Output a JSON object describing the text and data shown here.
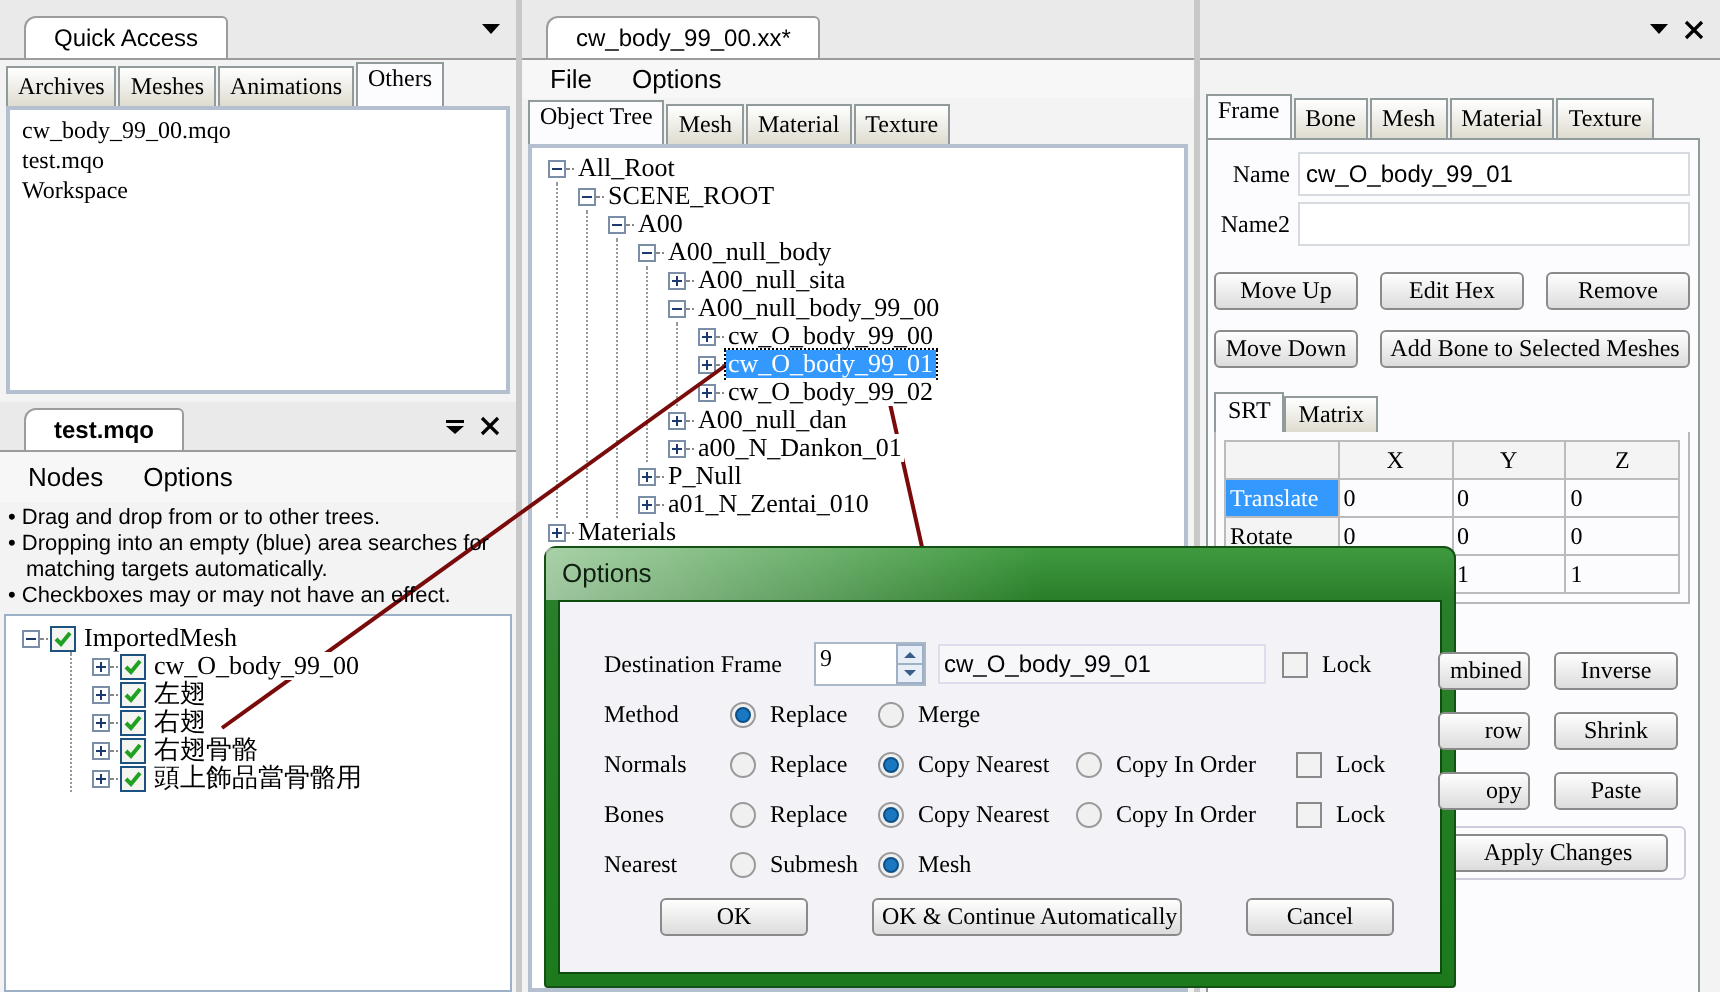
{
  "quick_access": {
    "title": "Quick Access",
    "tabs": [
      {
        "label": "Archives",
        "selected": false
      },
      {
        "label": "Meshes",
        "selected": false
      },
      {
        "label": "Animations",
        "selected": false
      },
      {
        "label": "Others",
        "selected": true
      }
    ],
    "items": [
      "cw_body_99_00.mqo",
      "test.mqo",
      "Workspace"
    ]
  },
  "mesh_panel": {
    "title": "test.mqo",
    "menu": [
      "Nodes",
      "Options"
    ],
    "notes": [
      "• Drag and drop from or to other trees.",
      "• Dropping into an empty (blue) area searches for matching targets automatically.",
      "• Checkboxes may or may not have an effect."
    ],
    "tree": [
      {
        "label": "ImportedMesh",
        "checked": true,
        "expanded": true,
        "children": [
          {
            "label": "cw_O_body_99_00",
            "checked": true,
            "expanded": false
          },
          {
            "label": "左翅",
            "checked": true,
            "expanded": false
          },
          {
            "label": "右翅",
            "checked": true,
            "expanded": false
          },
          {
            "label": "右翅骨骼",
            "checked": true,
            "expanded": false
          },
          {
            "label": "頭上飾品當骨骼用",
            "checked": true,
            "expanded": false
          }
        ]
      }
    ]
  },
  "editor": {
    "title": "cw_body_99_00.xx*",
    "menu": [
      "File",
      "Options"
    ],
    "tabs": [
      {
        "label": "Object Tree",
        "selected": true
      },
      {
        "label": "Mesh",
        "selected": false
      },
      {
        "label": "Material",
        "selected": false
      },
      {
        "label": "Texture",
        "selected": false
      }
    ],
    "tree": [
      {
        "label": "All_Root",
        "expanded": true,
        "selected": false,
        "children": [
          {
            "label": "SCENE_ROOT",
            "expanded": true,
            "selected": false,
            "children": [
              {
                "label": "A00",
                "expanded": true,
                "selected": false,
                "children": [
                  {
                    "label": "A00_null_body",
                    "expanded": true,
                    "selected": false,
                    "children": [
                      {
                        "label": "A00_null_sita",
                        "expanded": false,
                        "selected": false
                      },
                      {
                        "label": "A00_null_body_99_00",
                        "expanded": true,
                        "selected": false,
                        "children": [
                          {
                            "label": "cw_O_body_99_00",
                            "expanded": false,
                            "selected": false
                          },
                          {
                            "label": "cw_O_body_99_01",
                            "expanded": false,
                            "selected": true
                          },
                          {
                            "label": "cw_O_body_99_02",
                            "expanded": false,
                            "selected": false
                          }
                        ]
                      },
                      {
                        "label": "A00_null_dan",
                        "expanded": false,
                        "selected": false
                      },
                      {
                        "label": "a00_N_Dankon_01",
                        "expanded": false,
                        "selected": false
                      }
                    ]
                  },
                  {
                    "label": "P_Null",
                    "expanded": false,
                    "selected": false
                  },
                  {
                    "label": "a01_N_Zentai_010",
                    "expanded": false,
                    "selected": false
                  }
                ]
              }
            ]
          }
        ]
      },
      {
        "label": "Materials",
        "expanded": false,
        "selected": false
      }
    ]
  },
  "frame_panel": {
    "tabs": [
      {
        "label": "Frame",
        "selected": true
      },
      {
        "label": "Bone",
        "selected": false
      },
      {
        "label": "Mesh",
        "selected": false
      },
      {
        "label": "Material",
        "selected": false
      },
      {
        "label": "Texture",
        "selected": false
      }
    ],
    "name": {
      "label": "Name",
      "value": "cw_O_body_99_01"
    },
    "name2": {
      "label": "Name2"
    },
    "buttons": [
      "Move Up",
      "Edit Hex",
      "Remove",
      "Move Down",
      "Add Bone to Selected Meshes"
    ],
    "subtabs": [
      {
        "label": "SRT",
        "selected": true
      },
      {
        "label": "Matrix",
        "selected": false
      }
    ],
    "grid": {
      "columns": [
        "X",
        "Y",
        "Z"
      ],
      "rows": [
        {
          "label": "Translate",
          "selected": true,
          "cells": [
            "0",
            "0",
            "0"
          ]
        },
        {
          "label": "Rotate",
          "selected": false,
          "cells": [
            "0",
            "0",
            "0"
          ]
        },
        {
          "cells": [
            null,
            "1",
            "1"
          ]
        }
      ]
    },
    "lower_buttons": [
      "mbined",
      "Inverse",
      "row",
      "Shrink",
      "opy",
      "Paste"
    ],
    "apply_button": "Apply Changes"
  },
  "dialog": {
    "title": "Options",
    "destination": {
      "label": "Destination Frame",
      "spin_value": "9",
      "frame_name": "cw_O_body_99_01",
      "lock": {
        "label": "Lock",
        "checked": false
      }
    },
    "rows": [
      {
        "label": "Method",
        "options": [
          {
            "label": "Replace",
            "selected": true
          },
          {
            "label": "Merge",
            "selected": false
          }
        ]
      },
      {
        "label": "Normals",
        "options": [
          {
            "label": "Replace",
            "selected": false
          },
          {
            "label": "Copy Nearest",
            "selected": true
          },
          {
            "label": "Copy In Order",
            "selected": false
          }
        ],
        "lock": {
          "label": "Lock",
          "checked": false
        }
      },
      {
        "label": "Bones",
        "options": [
          {
            "label": "Replace",
            "selected": false
          },
          {
            "label": "Copy Nearest",
            "selected": true
          },
          {
            "label": "Copy In Order",
            "selected": false
          }
        ],
        "lock": {
          "label": "Lock",
          "checked": false
        }
      },
      {
        "label": "Nearest",
        "options": [
          {
            "label": "Submesh",
            "selected": false
          },
          {
            "label": "Mesh",
            "selected": true
          }
        ]
      }
    ],
    "buttons": [
      "OK",
      "OK & Continue Automatically",
      "Cancel"
    ]
  }
}
